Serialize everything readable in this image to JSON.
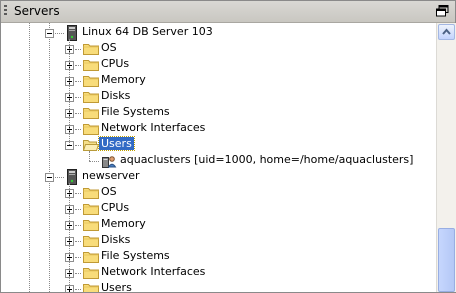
{
  "panel": {
    "title": "Servers"
  },
  "icons": {
    "folder": "folder-icon",
    "server": "server-icon",
    "user": "user-icon",
    "restore": "restore-icon"
  },
  "server1": {
    "name": "Linux 64 DB Server 103",
    "children": [
      "OS",
      "CPUs",
      "Memory",
      "Disks",
      "File Systems",
      "Network Interfaces",
      "Users"
    ],
    "user": "aquaclusters [uid=1000, home=/home/aquaclusters]"
  },
  "server2": {
    "name": "newserver",
    "children": [
      "OS",
      "CPUs",
      "Memory",
      "Disks",
      "File Systems",
      "Network Interfaces",
      "Users"
    ]
  },
  "selected": "Users"
}
